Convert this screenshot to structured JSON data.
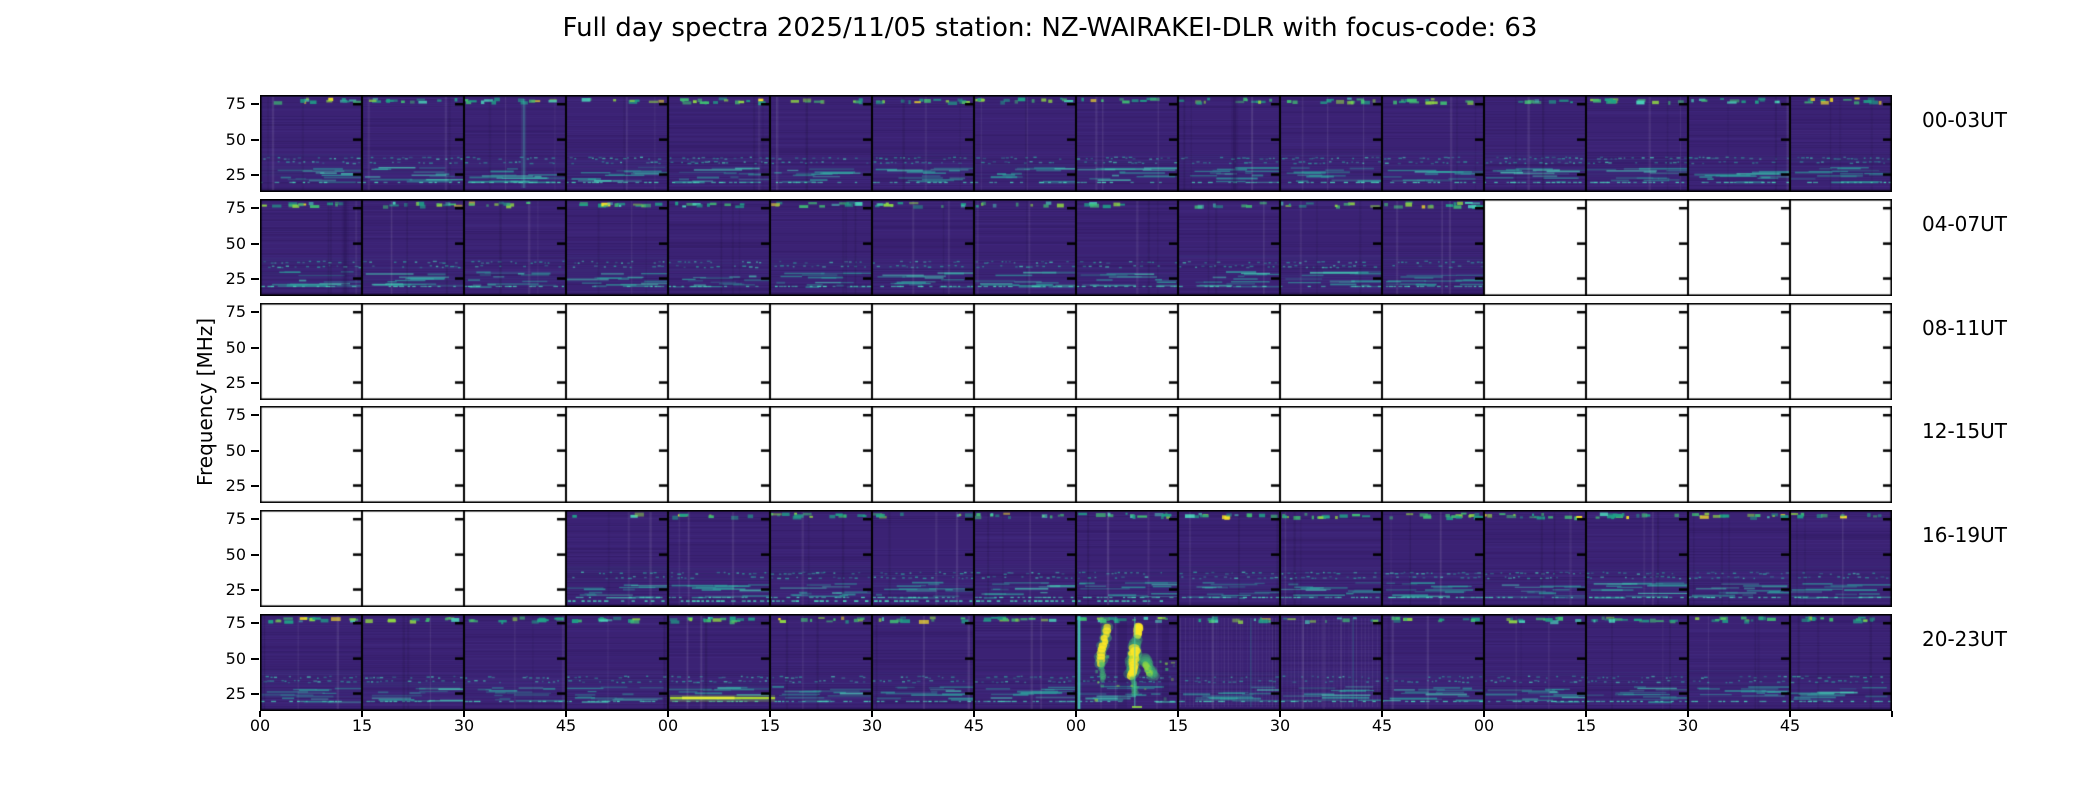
{
  "title": "Full day spectra 2025/11/05 station: NZ-WAIRAKEI-DLR with focus-code: 63",
  "ylabel": "Frequency [MHz]",
  "yticks": [
    "75",
    "50",
    "25"
  ],
  "xticks": [
    "00",
    "15",
    "30",
    "45",
    "00",
    "15",
    "30",
    "45",
    "00",
    "15",
    "30",
    "45",
    "00",
    "15",
    "30",
    "45"
  ],
  "rows": [
    {
      "label": "00-03UT",
      "panels": [
        1,
        1,
        1,
        1,
        1,
        1,
        1,
        1,
        1,
        1,
        1,
        1,
        1,
        1,
        1,
        1
      ],
      "features": [
        {
          "type": "light_vline",
          "pos": 2.58
        },
        {
          "type": "dark_vline",
          "pos": 9.55
        }
      ]
    },
    {
      "label": "04-07UT",
      "panels": [
        1,
        1,
        1,
        1,
        1,
        1,
        1,
        1,
        1,
        1,
        1,
        1,
        0,
        0,
        0,
        0
      ],
      "features": [
        {
          "type": "dark_vline",
          "pos": 0.83
        }
      ]
    },
    {
      "label": "08-11UT",
      "panels": [
        0,
        0,
        0,
        0,
        0,
        0,
        0,
        0,
        0,
        0,
        0,
        0,
        0,
        0,
        0,
        0
      ],
      "features": []
    },
    {
      "label": "12-15UT",
      "panels": [
        0,
        0,
        0,
        0,
        0,
        0,
        0,
        0,
        0,
        0,
        0,
        0,
        0,
        0,
        0,
        0
      ],
      "features": []
    },
    {
      "label": "16-19UT",
      "panels": [
        0,
        0,
        0,
        1,
        1,
        1,
        1,
        1,
        1,
        1,
        1,
        1,
        1,
        1,
        1,
        1
      ],
      "features": [
        {
          "type": "weak_top",
          "panels": [
            3
          ]
        },
        {
          "type": "bright_bottom",
          "panels": [
            3,
            4,
            5,
            6,
            7,
            8
          ]
        }
      ]
    },
    {
      "label": "20-23UT",
      "panels": [
        1,
        1,
        1,
        1,
        1,
        1,
        1,
        1,
        1,
        1,
        1,
        1,
        1,
        1,
        1,
        1
      ],
      "features": [
        {
          "type": "bright_hline",
          "from": 4.02,
          "to": 5.05,
          "yfrac": 0.866
        },
        {
          "type": "bright_vline",
          "pos": 8.02
        },
        {
          "type": "burst",
          "panel": 8
        },
        {
          "type": "striations",
          "panels": [
            9,
            10
          ]
        }
      ]
    }
  ],
  "palette": {
    "figure_bg": "#ffffff",
    "axis_color": "#000000",
    "spectro_base": "#3b2274",
    "spectro_dark": "#261250",
    "spectro_light": "#4c3792",
    "teal_wash": "#38598f",
    "speckle_teal": "#2fa3a0",
    "speckle_cyan": "#49d0b8",
    "band_teal": "#1fa187",
    "band_green": "#3fbc73",
    "band_lime": "#8fd744",
    "burst_yellow": "#fde725",
    "line_lime": "#b5dd2b",
    "line_lime_core": "#e8ef3a"
  },
  "chart_data": {
    "type": "heatmap",
    "title": "Full day spectra 2025/11/05 station: NZ-WAIRAKEI-DLR with focus-code: 63",
    "ylabel": "Frequency [MHz]",
    "yticks_mhz": [
      25,
      50,
      75
    ],
    "ylim_mhz_approx": [
      12,
      82
    ],
    "segments_per_row": 16,
    "segment_minutes": 15,
    "xtick_labels_per_hour": [
      "00",
      "15",
      "30",
      "45"
    ],
    "colormap": "viridis-like: dark purple background, teal/green speckle bands near 25 MHz and ~75-80 MHz, yellow for strongest emission",
    "rows": [
      {
        "label": "00-03UT",
        "hours": "00:00-04:00 UT",
        "data_segments": "all 16 segments present"
      },
      {
        "label": "04-07UT",
        "hours": "04:00-08:00 UT",
        "data_segments": "first 12 segments (04:00-07:00); 07:00-08:00 missing (white)"
      },
      {
        "label": "08-11UT",
        "hours": "08:00-12:00 UT",
        "data_segments": "no data (all white)"
      },
      {
        "label": "12-15UT",
        "hours": "12:00-16:00 UT",
        "data_segments": "no data (all white)"
      },
      {
        "label": "16-19UT",
        "hours": "16:00-20:00 UT",
        "data_segments": "last 13 segments (16:45-20:00); 16:00-16:45 missing (white)"
      },
      {
        "label": "20-23UT",
        "hours": "20:00-24:00 UT",
        "data_segments": "all 16 segments present",
        "annotations": [
          "strong yellow radio burst ~22:00-22:15 UT spanning ~25-80 MHz",
          "bright narrowband lime line near 22 MHz ~21:00-21:20 UT",
          "persistent teal/green dash band near 75-80 MHz",
          "speckled interference band near 25 MHz"
        ]
      }
    ]
  }
}
